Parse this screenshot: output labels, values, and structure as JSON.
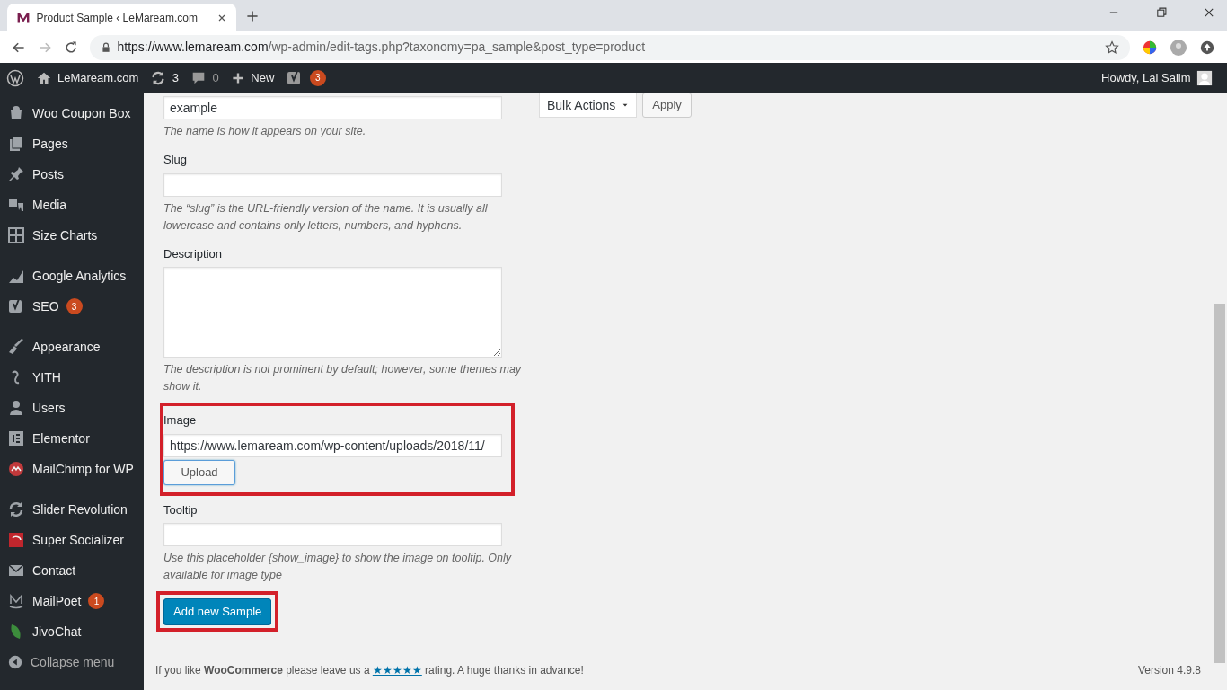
{
  "browser": {
    "tab_title": "Product Sample ‹ LeMaream.com",
    "url_host": "https://www.lemaream.com",
    "url_path": "/wp-admin/edit-tags.php?taxonomy=pa_sample&post_type=product"
  },
  "admin_bar": {
    "site": "LeMaream.com",
    "updates": "3",
    "comments": "0",
    "new": "New",
    "seo_badge": "3",
    "greeting": "Howdy, Lai Salim"
  },
  "sidebar": {
    "groups": [
      [
        {
          "label": "Woo Coupon Box"
        },
        {
          "label": "Pages"
        },
        {
          "label": "Posts"
        },
        {
          "label": "Media"
        },
        {
          "label": "Size Charts"
        }
      ],
      [
        {
          "label": "Google Analytics"
        },
        {
          "label": "SEO",
          "badge": "3"
        }
      ],
      [
        {
          "label": "Appearance"
        },
        {
          "label": "YITH"
        },
        {
          "label": "Users"
        },
        {
          "label": "Elementor"
        },
        {
          "label": "MailChimp for WP"
        }
      ],
      [
        {
          "label": "Slider Revolution"
        },
        {
          "label": "Super Socializer"
        },
        {
          "label": "Contact"
        },
        {
          "label": "MailPoet",
          "badge": "1"
        },
        {
          "label": "JivoChat"
        }
      ]
    ],
    "collapse": "Collapse menu"
  },
  "form": {
    "fields": [
      {
        "kind": "text",
        "value": "example",
        "hint": "The name is how it appears on your site.",
        "highlighted": false
      },
      {
        "kind": "text",
        "label": "Slug",
        "hint": "The “slug” is the URL-friendly version of the name. It is usually all lowercase and contains only letters, numbers, and hyphens.",
        "highlighted": false
      },
      {
        "kind": "textarea",
        "label": "Description",
        "hint": "The description is not prominent by default; however, some themes may show it.",
        "highlighted": false
      },
      {
        "kind": "upload",
        "label": "Image",
        "value": "https://www.lemaream.com/wp-content/uploads/2018/11/",
        "button": "Upload",
        "highlighted": true
      },
      {
        "kind": "text",
        "label": "Tooltip",
        "hint": "Use this placeholder {show_image} to show the image on tooltip. Only available for image type",
        "highlighted": false
      }
    ],
    "submit": {
      "label": "Add new Sample",
      "highlighted": true
    }
  },
  "bulk": {
    "select": "Bulk Actions",
    "apply": "Apply"
  },
  "footer": {
    "text_before": "If you like **WooCommerce** please leave us a",
    "link": "★★★★★",
    "text_after": "rating. A huge thanks in advance!",
    "version": "Version 4.9.8"
  }
}
